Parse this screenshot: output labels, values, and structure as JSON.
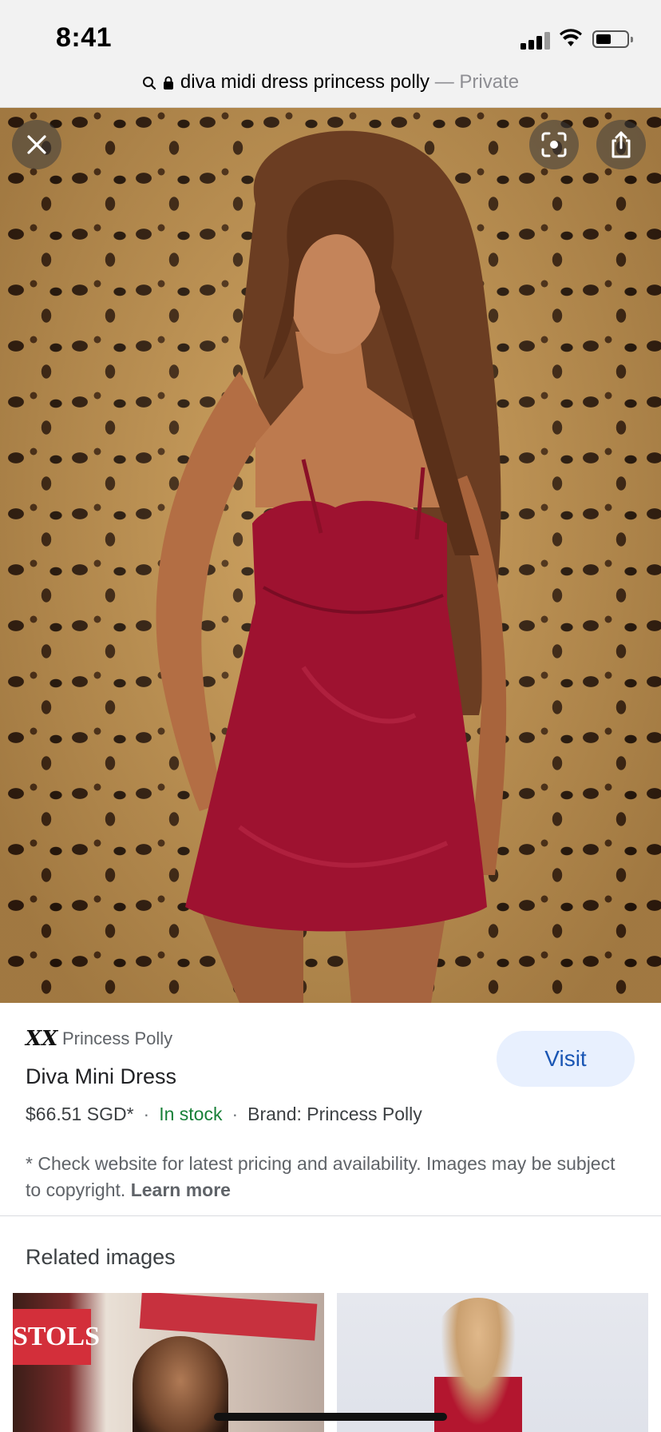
{
  "status_bar": {
    "time": "8:41"
  },
  "url_bar": {
    "query": "diva midi dress princess polly",
    "separator": " — ",
    "mode": "Private"
  },
  "hero": {
    "icons": [
      "close-icon",
      "lens-search-icon",
      "share-icon"
    ]
  },
  "product": {
    "site_logo": "XX",
    "site_name": "Princess Polly",
    "title": "Diva Mini Dress",
    "price": "$66.51 SGD*",
    "stock": "In stock",
    "brand": "Brand: Princess Polly",
    "visit_label": "Visit",
    "stock_color": "#188038",
    "visit_color": "#1a56b4"
  },
  "disclaimer": {
    "text": "* Check website for latest pricing and availability. Images may be subject to copyright. ",
    "learn_more": "Learn more"
  },
  "related": {
    "title": "Related images",
    "thumb_left_sign": "STOLS"
  }
}
